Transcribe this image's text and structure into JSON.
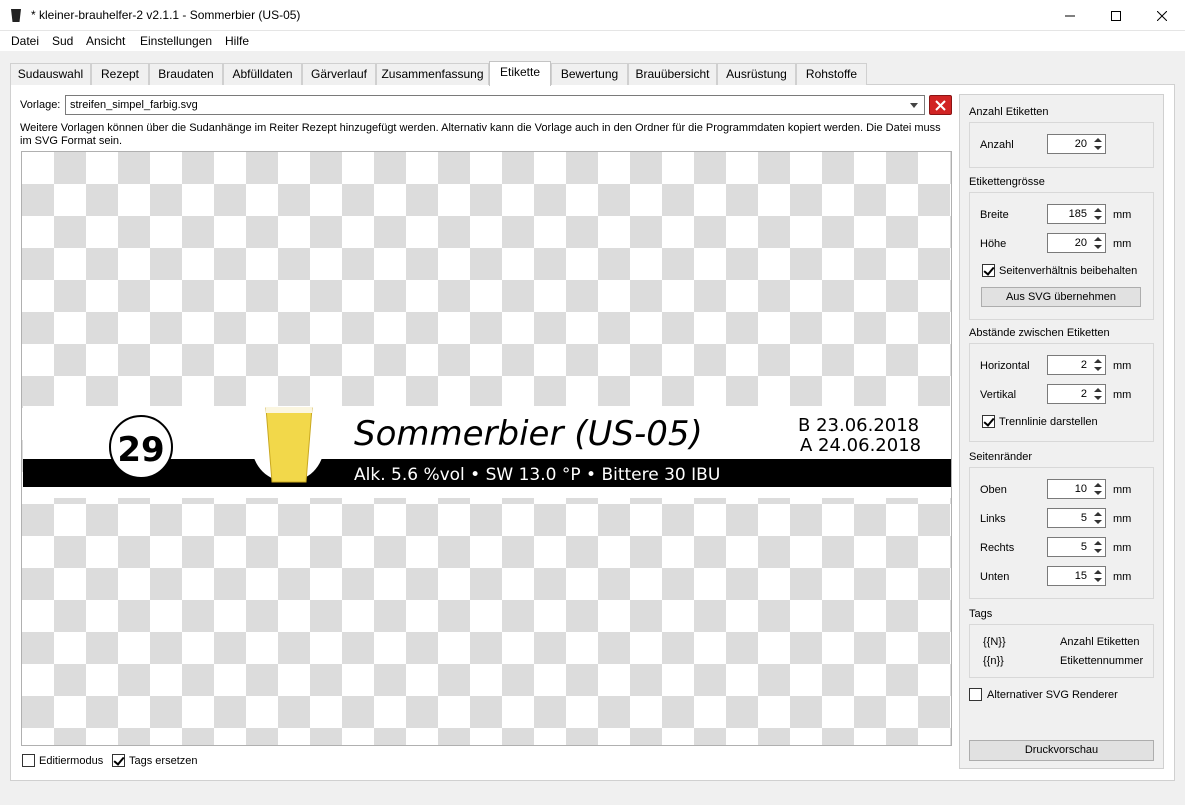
{
  "window": {
    "title": "* kleiner-brauhelfer-2 v2.1.1 - Sommerbier (US-05)"
  },
  "menu": [
    "Datei",
    "Sud",
    "Ansicht",
    "Einstellungen",
    "Hilfe"
  ],
  "tabs": [
    "Sudauswahl",
    "Rezept",
    "Braudaten",
    "Abfülldaten",
    "Gärverlauf",
    "Zusammenfassung",
    "Etikette",
    "Bewertung",
    "Brauübersicht",
    "Ausrüstung",
    "Rohstoffe"
  ],
  "active_tab": "Etikette",
  "template": {
    "label": "Vorlage:",
    "value": "streifen_simpel_farbig.svg",
    "hint": "Weitere Vorlagen können über die Sudanhänge im Reiter Rezept hinzugefügt werden. Alternativ kann die Vorlage auch in den Ordner für die Programmdaten kopiert werden. Die Datei muss im SVG Format sein."
  },
  "preview": {
    "number": "29",
    "beer_name": "Sommerbier (US-05)",
    "brew_date": "B 23.06.2018",
    "bottling_date": "A 24.06.2018",
    "stats": "Alk. 5.6 %vol  •  SW 13.0 °P  •  Bittere 30 IBU",
    "beer_color": "#f2d84a"
  },
  "bottom": {
    "edit_mode": "Editiermodus",
    "edit_mode_checked": false,
    "replace_tags": "Tags ersetzen",
    "replace_tags_checked": true
  },
  "settings": {
    "count": {
      "title": "Anzahl Etiketten",
      "label": "Anzahl",
      "value": "20"
    },
    "size": {
      "title": "Etikettengrösse",
      "width_label": "Breite",
      "width_value": "185",
      "height_label": "Höhe",
      "height_value": "20",
      "unit": "mm",
      "keep_ratio": "Seitenverhältnis beibehalten",
      "keep_ratio_checked": true,
      "from_svg_button": "Aus SVG übernehmen"
    },
    "spacing": {
      "title": "Abstände zwischen Etiketten",
      "horizontal_label": "Horizontal",
      "horizontal_value": "2",
      "vertical_label": "Vertikal",
      "vertical_value": "2",
      "unit": "mm",
      "separator": "Trennlinie darstellen",
      "separator_checked": true
    },
    "margins": {
      "title": "Seitenränder",
      "top_label": "Oben",
      "top_value": "10",
      "left_label": "Links",
      "left_value": "5",
      "right_label": "Rechts",
      "right_value": "5",
      "bottom_label": "Unten",
      "bottom_value": "15",
      "unit": "mm"
    },
    "tags": {
      "title": "Tags",
      "rows": [
        {
          "tag": "{{N}}",
          "desc": "Anzahl Etiketten"
        },
        {
          "tag": "{{n}}",
          "desc": "Etikettennummer"
        }
      ]
    },
    "alt_renderer": "Alternativer SVG Renderer",
    "alt_renderer_checked": false,
    "print_preview_button": "Druckvorschau"
  }
}
